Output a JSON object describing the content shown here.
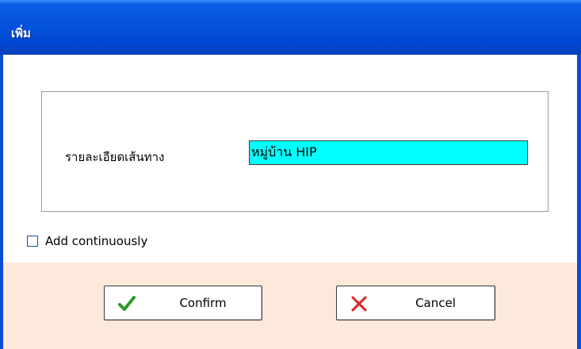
{
  "window": {
    "title": "เพิ่ม"
  },
  "form": {
    "route_label": "รายละเอียดเส้นทาง",
    "route_value": "หมู่บ้าน HIP"
  },
  "options": {
    "add_continuously_label": "Add continuously",
    "add_continuously_checked": false
  },
  "buttons": {
    "confirm_label": "Confirm",
    "confirm_icon": "check-icon",
    "cancel_label": "Cancel",
    "cancel_icon": "x-icon"
  },
  "colors": {
    "titlebar": "#0553dc",
    "input_background": "#00ffff",
    "button_area_background": "#fde9dc",
    "confirm_icon_color": "#2a9a2a",
    "cancel_icon_color": "#e02020"
  }
}
